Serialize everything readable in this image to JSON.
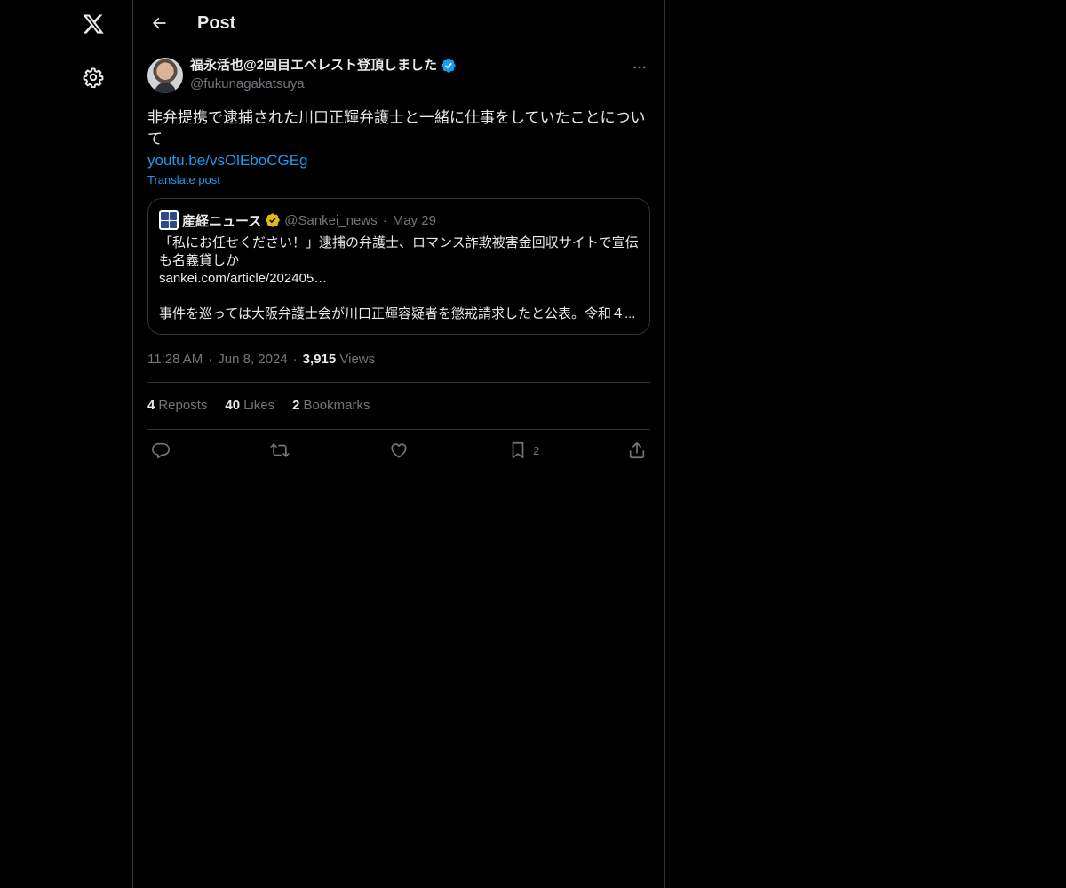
{
  "nav": {
    "logo_icon": "x-logo-icon",
    "settings_icon": "gear-icon"
  },
  "header": {
    "title": "Post",
    "back_icon": "arrow-left-icon"
  },
  "post": {
    "author_name": "福永活也@2回目エベレスト登頂しました",
    "author_handle": "@fukunagakatsuya",
    "verified": true,
    "text": "非弁提携で逮捕された川口正輝弁護士と一緒に仕事をしていたことについて",
    "link": "youtu.be/vsOlEboCGEg",
    "translate_label": "Translate post",
    "time": "11:28 AM",
    "date": "Jun 8, 2024",
    "views_count": "3,915",
    "views_label": "Views"
  },
  "quote": {
    "name": "産経ニュース",
    "handle": "@Sankei_news",
    "date": "May 29",
    "line1": "「私にお任せください！」逮捕の弁護士、ロマンス詐欺被害金回収サイトで宣伝も名義貸しか",
    "line2": "sankei.com/article/202405…",
    "line3": "事件を巡っては大阪弁護士会が川口正輝容疑者を懲戒請求したと公表。令和４..."
  },
  "stats": {
    "reposts_count": "4",
    "reposts_label": "Reposts",
    "likes_count": "40",
    "likes_label": "Likes",
    "bookmarks_count": "2",
    "bookmarks_label": "Bookmarks"
  },
  "actions": {
    "bookmark_count": "2"
  },
  "colors": {
    "background": "#000000",
    "text": "#e7e9ea",
    "muted": "#71767b",
    "accent": "#1d9bf0",
    "border": "#2f3336",
    "gold_verified": "#e2b719"
  }
}
